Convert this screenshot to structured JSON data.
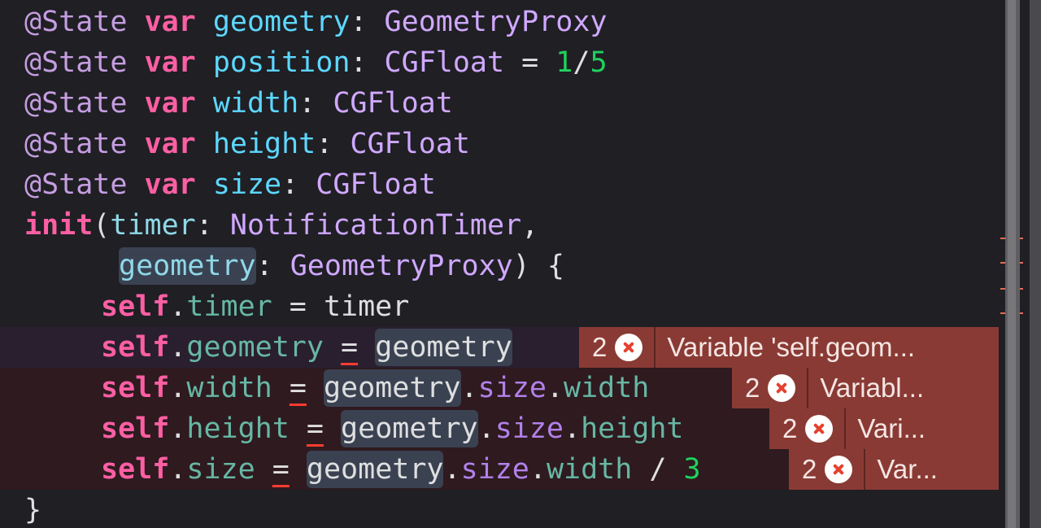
{
  "code_lines": [
    {
      "id": "state-geometry",
      "tokens": [
        {
          "t": "@State",
          "c": "k-attr"
        },
        {
          "t": " ",
          "c": "k-plain"
        },
        {
          "t": "var",
          "c": "k-kw"
        },
        {
          "t": " ",
          "c": "k-plain"
        },
        {
          "t": "geometry",
          "c": "k-id"
        },
        {
          "t": ": ",
          "c": "k-plain"
        },
        {
          "t": "GeometryProxy",
          "c": "k-type"
        }
      ]
    },
    {
      "id": "state-position",
      "tokens": [
        {
          "t": "@State",
          "c": "k-attr"
        },
        {
          "t": " ",
          "c": "k-plain"
        },
        {
          "t": "var",
          "c": "k-kw"
        },
        {
          "t": " ",
          "c": "k-plain"
        },
        {
          "t": "position",
          "c": "k-id"
        },
        {
          "t": ": ",
          "c": "k-plain"
        },
        {
          "t": "CGFloat",
          "c": "k-type"
        },
        {
          "t": " = ",
          "c": "k-plain"
        },
        {
          "t": "1",
          "c": "k-num"
        },
        {
          "t": "/",
          "c": "k-plain"
        },
        {
          "t": "5",
          "c": "k-num"
        }
      ]
    },
    {
      "id": "state-width",
      "tokens": [
        {
          "t": "@State",
          "c": "k-attr"
        },
        {
          "t": " ",
          "c": "k-plain"
        },
        {
          "t": "var",
          "c": "k-kw"
        },
        {
          "t": " ",
          "c": "k-plain"
        },
        {
          "t": "width",
          "c": "k-id"
        },
        {
          "t": ": ",
          "c": "k-plain"
        },
        {
          "t": "CGFloat",
          "c": "k-type"
        }
      ]
    },
    {
      "id": "state-height",
      "tokens": [
        {
          "t": "@State",
          "c": "k-attr"
        },
        {
          "t": " ",
          "c": "k-plain"
        },
        {
          "t": "var",
          "c": "k-kw"
        },
        {
          "t": " ",
          "c": "k-plain"
        },
        {
          "t": "height",
          "c": "k-id"
        },
        {
          "t": ": ",
          "c": "k-plain"
        },
        {
          "t": "CGFloat",
          "c": "k-type"
        }
      ]
    },
    {
      "id": "state-size",
      "tokens": [
        {
          "t": "@State",
          "c": "k-attr"
        },
        {
          "t": " ",
          "c": "k-plain"
        },
        {
          "t": "var",
          "c": "k-kw"
        },
        {
          "t": " ",
          "c": "k-plain"
        },
        {
          "t": "size",
          "c": "k-id"
        },
        {
          "t": ": ",
          "c": "k-plain"
        },
        {
          "t": "CGFloat",
          "c": "k-type"
        }
      ]
    },
    {
      "id": "init-signature",
      "tokens": [
        {
          "t": "init",
          "c": "k-kw"
        },
        {
          "t": "(",
          "c": "k-plain"
        },
        {
          "t": "timer",
          "c": "k-param"
        },
        {
          "t": ": ",
          "c": "k-plain"
        },
        {
          "t": "NotificationTimer",
          "c": "k-type"
        },
        {
          "t": ",",
          "c": "k-plain"
        }
      ]
    },
    {
      "id": "init-geometry-param",
      "tokens": [
        {
          "t": "geometry",
          "c": "k-param",
          "ph": true
        },
        {
          "t": ": ",
          "c": "k-plain"
        },
        {
          "t": "GeometryProxy",
          "c": "k-type"
        },
        {
          "t": ") {",
          "c": "k-plain"
        }
      ]
    },
    {
      "id": "assign-timer",
      "tokens": [
        {
          "t": "self",
          "c": "k-kw"
        },
        {
          "t": ".",
          "c": "k-plain"
        },
        {
          "t": "timer",
          "c": "k-prop"
        },
        {
          "t": " = ",
          "c": "k-plain"
        },
        {
          "t": "timer",
          "c": "k-plain"
        }
      ]
    },
    {
      "id": "assign-geometry",
      "tokens": [
        {
          "t": "self",
          "c": "k-kw"
        },
        {
          "t": ".",
          "c": "k-plain"
        },
        {
          "t": "geometry",
          "c": "k-prop"
        },
        {
          "t": " ",
          "c": "k-plain"
        },
        {
          "t": "=",
          "c": "k-plain",
          "sq": true
        },
        {
          "t": " ",
          "c": "k-plain"
        },
        {
          "t": "geometry",
          "c": "k-plain",
          "ph": true
        }
      ],
      "error": {
        "count": "2",
        "message": "Variable 'self.geom..."
      }
    },
    {
      "id": "assign-width",
      "tokens": [
        {
          "t": "self",
          "c": "k-kw"
        },
        {
          "t": ".",
          "c": "k-plain"
        },
        {
          "t": "width",
          "c": "k-prop"
        },
        {
          "t": " ",
          "c": "k-plain"
        },
        {
          "t": "=",
          "c": "k-plain",
          "sq": true
        },
        {
          "t": " ",
          "c": "k-plain"
        },
        {
          "t": "geometry",
          "c": "k-plain",
          "ph": true
        },
        {
          "t": ".",
          "c": "k-plain"
        },
        {
          "t": "size",
          "c": "k-mem"
        },
        {
          "t": ".",
          "c": "k-plain"
        },
        {
          "t": "width",
          "c": "k-prop"
        }
      ],
      "error": {
        "count": "2",
        "message": "Variabl..."
      }
    },
    {
      "id": "assign-height",
      "tokens": [
        {
          "t": "self",
          "c": "k-kw"
        },
        {
          "t": ".",
          "c": "k-plain"
        },
        {
          "t": "height",
          "c": "k-prop"
        },
        {
          "t": " ",
          "c": "k-plain"
        },
        {
          "t": "=",
          "c": "k-plain",
          "sq": true
        },
        {
          "t": " ",
          "c": "k-plain"
        },
        {
          "t": "geometry",
          "c": "k-plain",
          "ph": true
        },
        {
          "t": ".",
          "c": "k-plain"
        },
        {
          "t": "size",
          "c": "k-mem"
        },
        {
          "t": ".",
          "c": "k-plain"
        },
        {
          "t": "height",
          "c": "k-prop"
        }
      ],
      "error": {
        "count": "2",
        "message": "Vari..."
      }
    },
    {
      "id": "assign-size",
      "tokens": [
        {
          "t": "self",
          "c": "k-kw"
        },
        {
          "t": ".",
          "c": "k-plain"
        },
        {
          "t": "size",
          "c": "k-prop"
        },
        {
          "t": " ",
          "c": "k-plain"
        },
        {
          "t": "=",
          "c": "k-plain",
          "sq": true
        },
        {
          "t": " ",
          "c": "k-plain"
        },
        {
          "t": "geometry",
          "c": "k-plain",
          "ph": true
        },
        {
          "t": ".",
          "c": "k-plain"
        },
        {
          "t": "size",
          "c": "k-mem"
        },
        {
          "t": ".",
          "c": "k-plain"
        },
        {
          "t": "width",
          "c": "k-prop"
        },
        {
          "t": " / ",
          "c": "k-plain"
        },
        {
          "t": "3",
          "c": "k-num"
        }
      ],
      "error": {
        "count": "2",
        "message": "Var..."
      }
    },
    {
      "id": "closing-brace",
      "tokens": [
        {
          "t": "}",
          "c": "k-plain"
        }
      ]
    }
  ],
  "colors": {
    "background": "#1f1f24",
    "error_badge": "#8a3a34",
    "keyword": "#fc5fa3",
    "type": "#d0a8ff",
    "identifier": "#5dd8ff",
    "number": "#1fd25e"
  }
}
